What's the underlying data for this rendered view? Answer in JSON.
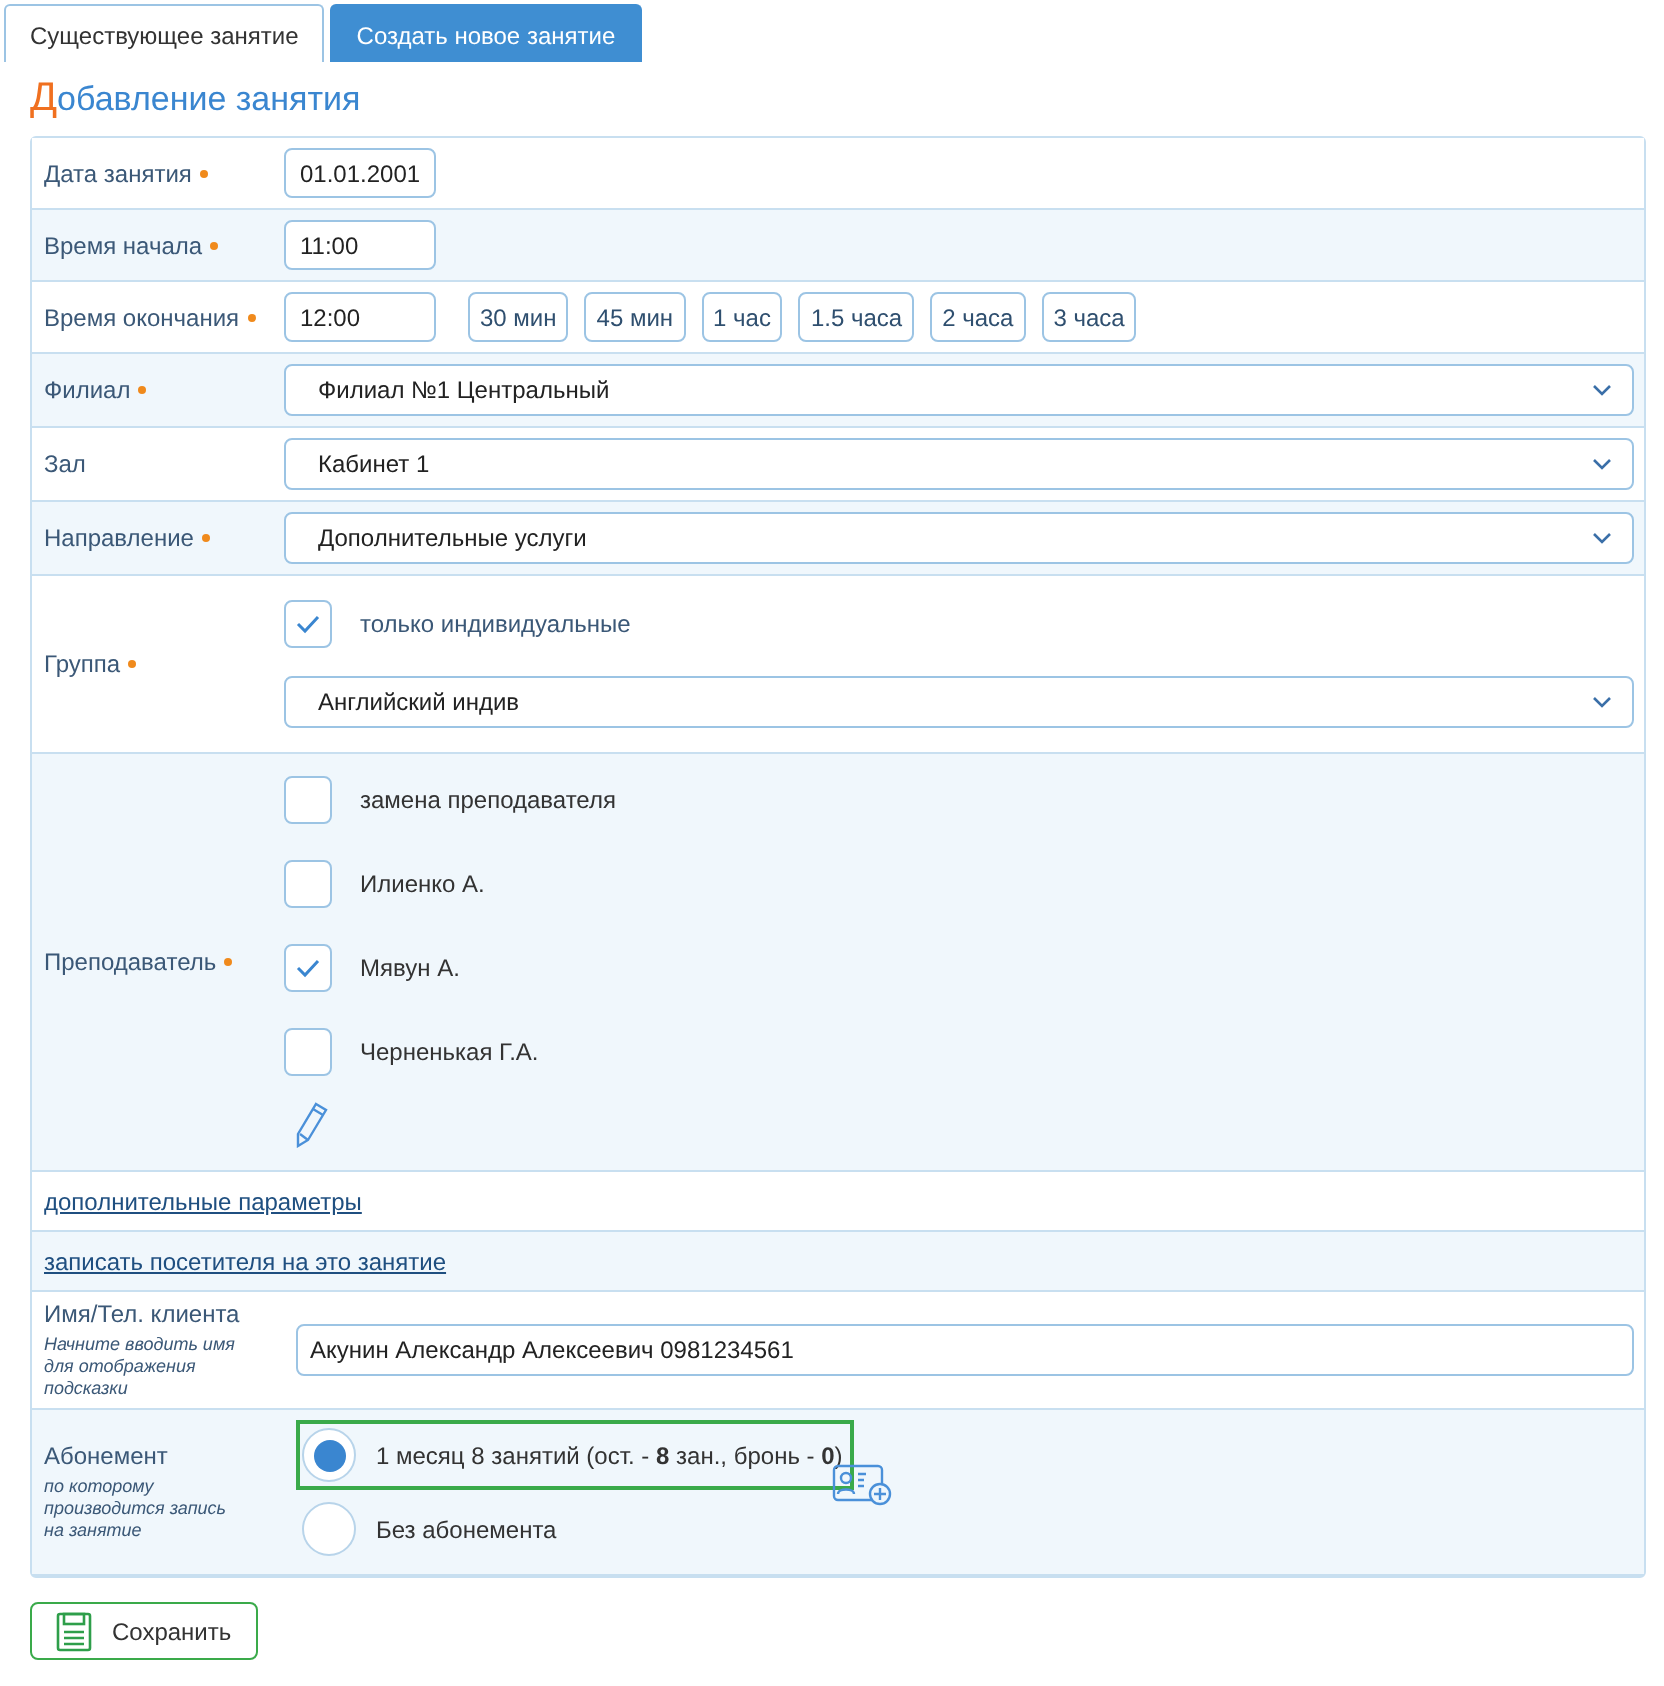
{
  "tabs": [
    {
      "label": "Существующее занятие",
      "selected": true
    },
    {
      "label": "Создать новое занятие",
      "selected": false
    }
  ],
  "title": "Добавление занятия",
  "rows": [
    {
      "kind": "input",
      "label": "Дата занятия",
      "required": true,
      "value": "01.01.2001"
    },
    {
      "kind": "input",
      "label": "Время начала",
      "required": true,
      "value": "11:00"
    },
    {
      "kind": "input",
      "label": "Время окончания",
      "required": true,
      "value": "12:00",
      "presets": [
        "30 мин",
        "45 мин",
        "1 час",
        "1.5 часа",
        "2 часа",
        "3 часа"
      ]
    },
    {
      "kind": "select",
      "label": "Филиал",
      "required": true,
      "value": "Филиал №1 Центральный"
    },
    {
      "kind": "select",
      "label": "Зал",
      "required": false,
      "value": "Кабинет 1"
    },
    {
      "kind": "select",
      "label": "Направление",
      "required": true,
      "value": "Дополнительные услуги"
    },
    {
      "kind": "group",
      "label": "Группа",
      "required": true,
      "checkbox": {
        "label": "только индивидуальные",
        "checked": true
      },
      "value": "Английский индив"
    },
    {
      "kind": "checklist",
      "label": "Преподаватель",
      "required": true,
      "items": [
        {
          "label": "замена преподавателя",
          "checked": false
        },
        {
          "label": "Илиенко А.",
          "checked": false
        },
        {
          "label": "Мявун А.",
          "checked": true
        },
        {
          "label": "Черненькая Г.А.",
          "checked": false
        }
      ]
    },
    {
      "kind": "link",
      "label": "дополнительные параметры"
    },
    {
      "kind": "link",
      "label": "записать посетителя на это занятие"
    },
    {
      "kind": "client",
      "label": "Имя/Тел. клиента",
      "hint": "Начните вводить имя для отображения подсказки",
      "value": "Акунин Александр Алексеевич 0981234561"
    },
    {
      "kind": "radios",
      "label": "Абонемент",
      "hint": "по которому производится запись на занятие",
      "options": [
        {
          "label": "1 месяц 8 занятий (ост. - **8** зан., бронь - **0**)",
          "selected": true
        },
        {
          "label": "Без абонемента",
          "selected": false
        }
      ]
    }
  ],
  "save": "Сохранить"
}
